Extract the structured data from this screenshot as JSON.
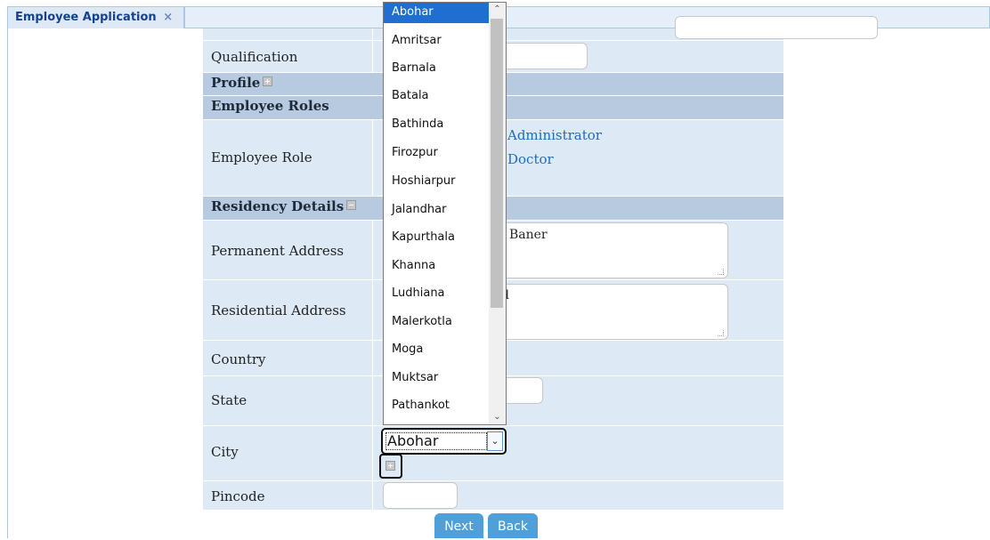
{
  "tab": {
    "title": "Employee Application",
    "close": "×"
  },
  "form": {
    "qualification_label": "Qualification",
    "profile_header": "Profile",
    "roles_header": "Employee Roles",
    "employee_role_label": "Employee Role",
    "roles": [
      "Administrator",
      "Doctor"
    ],
    "residency_header": "Residency Details",
    "permanent_address_label": "Permanent Address",
    "permanent_address_value": "Baner",
    "residential_address_label": "Residential Address",
    "residential_address_value": "d",
    "country_label": "Country",
    "state_label": "State",
    "city_label": "City",
    "city_value": "Abohar",
    "pincode_label": "Pincode"
  },
  "city_dropdown": {
    "selected": "Abohar",
    "options": [
      "Abohar",
      "Amritsar",
      "Barnala",
      "Batala",
      "Bathinda",
      "Firozpur",
      "Hoshiarpur",
      "Jalandhar",
      "Kapurthala",
      "Khanna",
      "Ludhiana",
      "Malerkotla",
      "Moga",
      "Muktsar",
      "Pathankot"
    ]
  },
  "buttons": {
    "next": "Next",
    "back": "Back"
  },
  "icons": {
    "expand": "plus-box-icon",
    "collapse": "minus-box-icon",
    "dropdown": "chevron-down-icon"
  },
  "colors": {
    "accent": "#4fa0d8",
    "section": "#b7cae0",
    "row": "#ddeaf6",
    "link": "#1f6bb8",
    "selected": "#1e6fd0"
  }
}
